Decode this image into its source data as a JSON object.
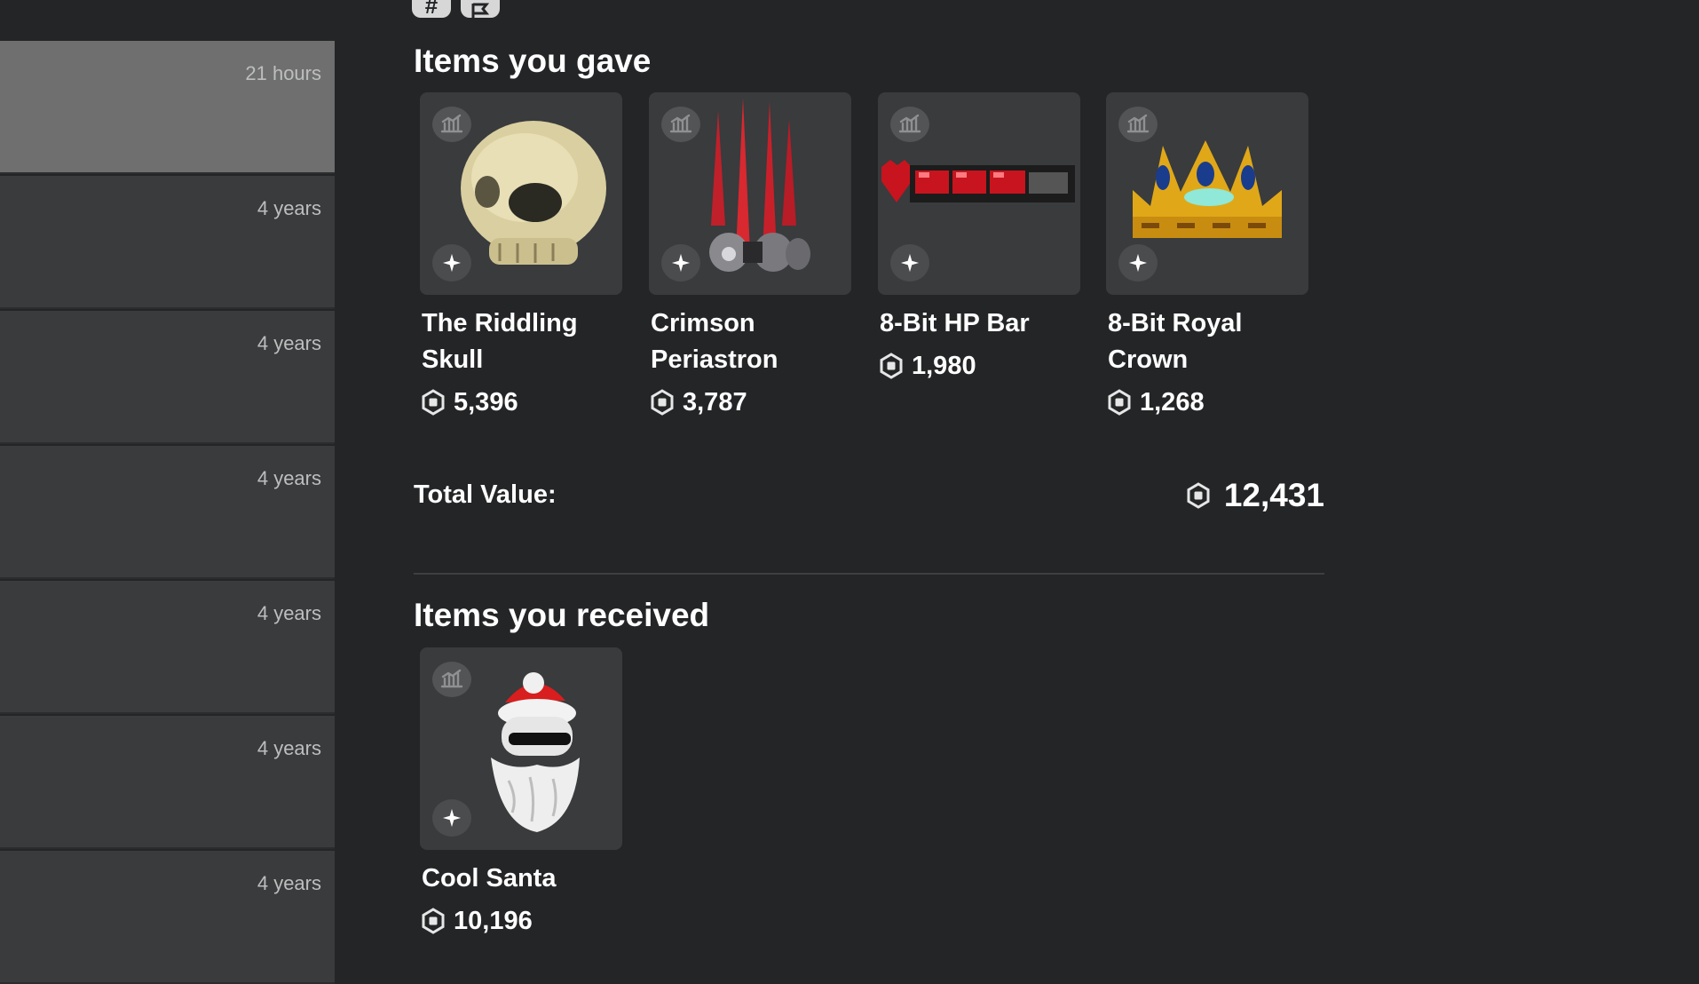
{
  "sidebar": {
    "trades": [
      {
        "time": "21 hours",
        "selected": true
      },
      {
        "time": "4 years"
      },
      {
        "time": "4 years"
      },
      {
        "time": "4 years"
      },
      {
        "time": "4 years"
      },
      {
        "time": "4 years"
      },
      {
        "time": "4 years"
      }
    ]
  },
  "top_icons": [
    "hash-icon",
    "flag-icon"
  ],
  "gave": {
    "title": "Items you gave",
    "items": [
      {
        "name": "The Riddling Skull",
        "price": "5,396",
        "icon": "skull"
      },
      {
        "name": "Crimson Periastron",
        "price": "3,787",
        "icon": "periastron"
      },
      {
        "name": "8-Bit HP Bar",
        "price": "1,980",
        "icon": "hp-bar"
      },
      {
        "name": "8-Bit Royal Crown",
        "price": "1,268",
        "icon": "crown"
      }
    ],
    "total_label": "Total Value:",
    "total_value": "12,431"
  },
  "received": {
    "title": "Items you received",
    "items": [
      {
        "name": "Cool Santa",
        "price": "10,196",
        "icon": "santa"
      }
    ]
  },
  "colors": {
    "background": "#232527",
    "row": "#393b3d",
    "row_selected": "#6f6f70"
  }
}
